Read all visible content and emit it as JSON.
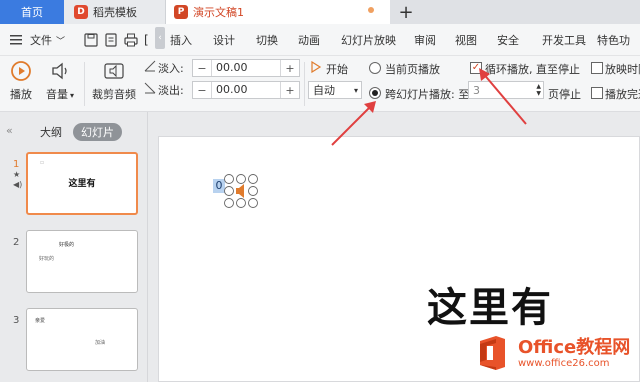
{
  "tabs": {
    "home": "首页",
    "template": "稻壳模板",
    "document": "演示文稿1"
  },
  "menu": {
    "file": "文件",
    "items": [
      "插入",
      "设计",
      "切换",
      "动画",
      "幻灯片放映",
      "审阅",
      "视图",
      "安全",
      "开发工具",
      "特色功"
    ]
  },
  "ribbon": {
    "play": "播放",
    "volume": "音量",
    "trim": "裁剪音频",
    "fade_in_label": "淡入:",
    "fade_in_value": "00.00",
    "fade_out_label": "淡出:",
    "fade_out_value": "00.00",
    "start_label": "开始",
    "start_value": "自动",
    "current_page_play": "当前页播放",
    "cross_slide_play": "跨幻灯片播放: 至",
    "cross_slide_to_value": "3",
    "page_stop": "页停止",
    "loop_play": "循环播放, 直至停止",
    "hide_when_play": "放映时隐",
    "rewind_after": "播放完返"
  },
  "panel": {
    "outline_tab": "大纲",
    "slides_tab": "幻灯片",
    "slides": [
      {
        "number": "1",
        "title": "这里有",
        "subtitle": ""
      },
      {
        "number": "2",
        "title": "好极的",
        "subtitle": "好玩的"
      },
      {
        "number": "3",
        "title": "亲爱",
        "subtitle": "加油"
      }
    ]
  },
  "canvas": {
    "title": "这里有",
    "audio_marker": "0"
  },
  "watermark": {
    "brand": "Office教程网",
    "url": "www.office26.com"
  },
  "colors": {
    "accent": "#d24726",
    "home_tab": "#3b7be0",
    "arrow": "#e04040",
    "selection": "#f08a4b"
  }
}
